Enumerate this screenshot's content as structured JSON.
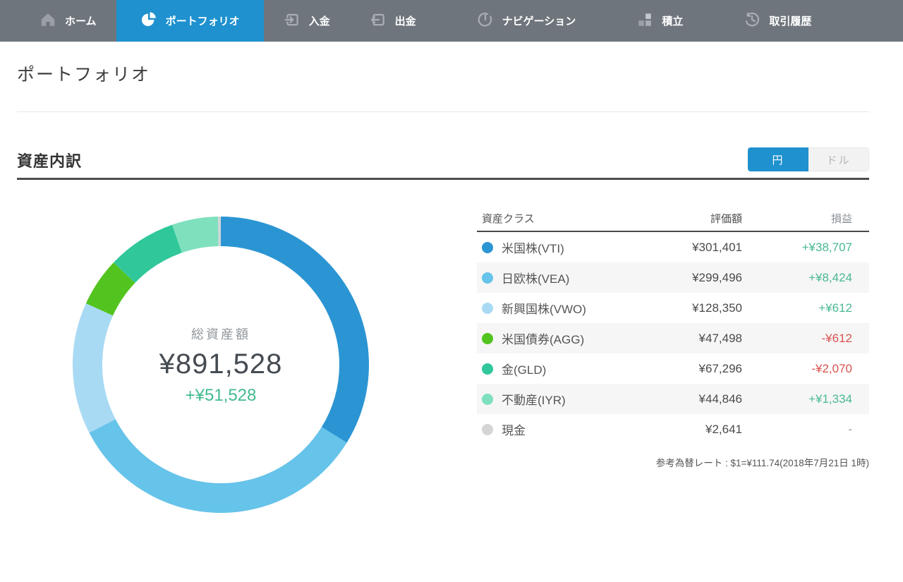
{
  "nav": {
    "items": [
      {
        "label": "ホーム",
        "icon": "home-icon",
        "active": false
      },
      {
        "label": "ポートフォリオ",
        "icon": "pie-chart-icon",
        "active": true
      },
      {
        "label": "入金",
        "icon": "deposit-icon",
        "active": false
      },
      {
        "label": "出金",
        "icon": "withdraw-icon",
        "active": false
      },
      {
        "label": "ナビゲーション",
        "icon": "gauge-icon",
        "active": false
      },
      {
        "label": "積立",
        "icon": "blocks-icon",
        "active": false
      },
      {
        "label": "取引履歴",
        "icon": "history-icon",
        "active": false
      }
    ]
  },
  "page": {
    "title": "ポートフォリオ"
  },
  "section": {
    "title": "資産内訳"
  },
  "currency_toggle": {
    "yen_label": "円",
    "dollar_label": "ドル",
    "selected": "円"
  },
  "summary": {
    "label": "総資産額",
    "total": "¥891,528",
    "gain": "+¥51,528"
  },
  "table": {
    "headers": {
      "asset_class": "資産クラス",
      "value": "評価額",
      "gain": "損益"
    }
  },
  "assets": {
    "rows": [
      {
        "name": "米国株(VTI)",
        "value": "¥301,401",
        "gain": "+¥38,707",
        "gain_type": "positive",
        "color": "#2b95d3"
      },
      {
        "name": "日欧株(VEA)",
        "value": "¥299,496",
        "gain": "+¥8,424",
        "gain_type": "positive",
        "color": "#66c3e9"
      },
      {
        "name": "新興国株(VWO)",
        "value": "¥128,350",
        "gain": "+¥612",
        "gain_type": "positive",
        "color": "#a9daf4"
      },
      {
        "name": "米国債券(AGG)",
        "value": "¥47,498",
        "gain": "-¥612",
        "gain_type": "negative",
        "color": "#53c41f"
      },
      {
        "name": "金(GLD)",
        "value": "¥67,296",
        "gain": "-¥2,070",
        "gain_type": "negative",
        "color": "#30c79b"
      },
      {
        "name": "不動産(IYR)",
        "value": "¥44,846",
        "gain": "+¥1,334",
        "gain_type": "positive",
        "color": "#7fe0bd"
      },
      {
        "name": "現金",
        "value": "¥2,641",
        "gain": "-",
        "gain_type": "none",
        "color": "#d5d5d5"
      }
    ]
  },
  "footer": {
    "exchange_rate_note": "参考為替レート : $1=¥111.74(2018年7月21日 1時)"
  },
  "colors": {
    "nav_background": "#6f757c",
    "accent_blue": "#1f91cf",
    "positive_green": "#49b893",
    "negative_red": "#d9534f",
    "row_alt_background": "#f6f6f6"
  },
  "chart_data": {
    "type": "pie",
    "subtype": "donut",
    "title": "資産内訳",
    "center_label": "総資産額",
    "center_value": "¥891,528",
    "center_gain": "+¥51,528",
    "total": 891528,
    "currency": "JPY",
    "start_angle_deg": 0,
    "direction": "clockwise",
    "series": [
      {
        "name": "米国株(VTI)",
        "value": 301401,
        "color": "#2b95d3"
      },
      {
        "name": "日欧株(VEA)",
        "value": 299496,
        "color": "#66c3e9"
      },
      {
        "name": "新興国株(VWO)",
        "value": 128350,
        "color": "#a9daf4"
      },
      {
        "name": "米国債券(AGG)",
        "value": 47498,
        "color": "#53c41f"
      },
      {
        "name": "金(GLD)",
        "value": 67296,
        "color": "#30c79b"
      },
      {
        "name": "不動産(IYR)",
        "value": 44846,
        "color": "#7fe0bd"
      },
      {
        "name": "現金",
        "value": 2641,
        "color": "#d2d5d8"
      }
    ]
  }
}
